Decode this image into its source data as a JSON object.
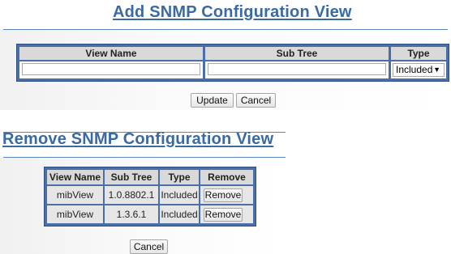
{
  "add": {
    "title": "Add SNMP Configuration View",
    "headers": {
      "view_name": "View Name",
      "sub_tree": "Sub Tree",
      "type": "Type"
    },
    "fields": {
      "view_name_value": "",
      "sub_tree_value": "",
      "type_selected": "Included"
    },
    "buttons": {
      "update": "Update",
      "cancel": "Cancel"
    }
  },
  "remove": {
    "title": "Remove SNMP Configuration View",
    "headers": {
      "view_name": "View Name",
      "sub_tree": "Sub Tree",
      "type": "Type",
      "remove": "Remove"
    },
    "rows": [
      {
        "view_name": "mibView",
        "sub_tree": "1.0.8802.1",
        "type": "Included",
        "button": "Remove"
      },
      {
        "view_name": "mibView",
        "sub_tree": "1.3.6.1",
        "type": "Included",
        "button": "Remove"
      }
    ],
    "buttons": {
      "cancel": "Cancel"
    }
  },
  "colors": {
    "title": "#3a6aa3",
    "table_border": "#4a6fa8",
    "header_bg": "#d9d9d9",
    "cell_bg": "#e6e6e6"
  },
  "icons": {
    "select_arrow": "triangle-down"
  }
}
